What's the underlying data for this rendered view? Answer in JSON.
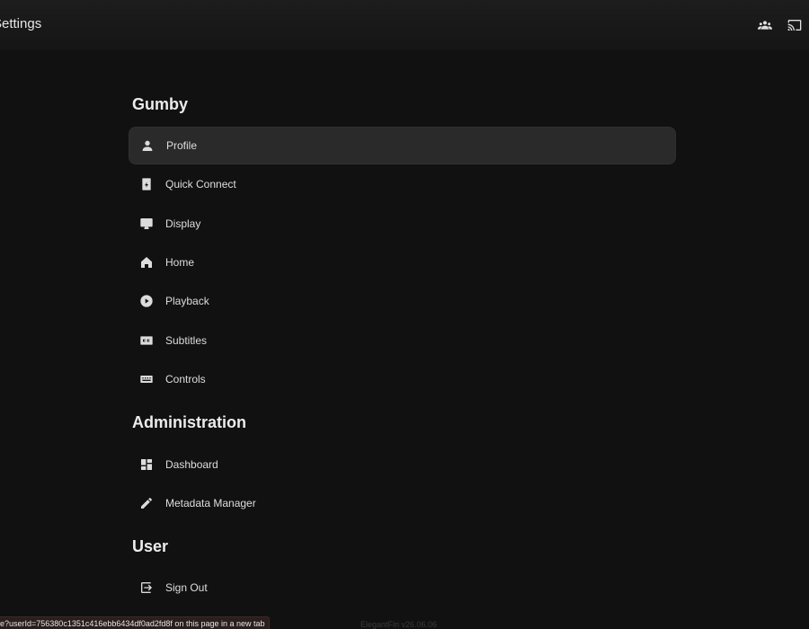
{
  "header": {
    "title": "Settings",
    "icons": [
      "users-icon",
      "cast-icon"
    ]
  },
  "sections": [
    {
      "title": "Gumby",
      "items": [
        {
          "label": "Profile",
          "icon": "person-icon",
          "active": true
        },
        {
          "label": "Quick Connect",
          "icon": "quick-connect-icon"
        },
        {
          "label": "Display",
          "icon": "monitor-icon"
        },
        {
          "label": "Home",
          "icon": "home-icon"
        },
        {
          "label": "Playback",
          "icon": "play-circle-icon"
        },
        {
          "label": "Subtitles",
          "icon": "closed-caption-icon"
        },
        {
          "label": "Controls",
          "icon": "keyboard-icon"
        }
      ]
    },
    {
      "title": "Administration",
      "items": [
        {
          "label": "Dashboard",
          "icon": "dashboard-icon"
        },
        {
          "label": "Metadata Manager",
          "icon": "pencil-icon"
        }
      ]
    },
    {
      "title": "User",
      "items": [
        {
          "label": "Sign Out",
          "icon": "sign-out-icon"
        }
      ]
    }
  ],
  "status_bar": "e?userId=756380c1351c416ebb6434df0ad2fd8f on this page in a new tab",
  "footer": {
    "version": "ElegantFin v26.06.06"
  },
  "colors": {
    "background": "#111111",
    "active_item": "#2a2a2a",
    "text": "#e8e8e8"
  }
}
